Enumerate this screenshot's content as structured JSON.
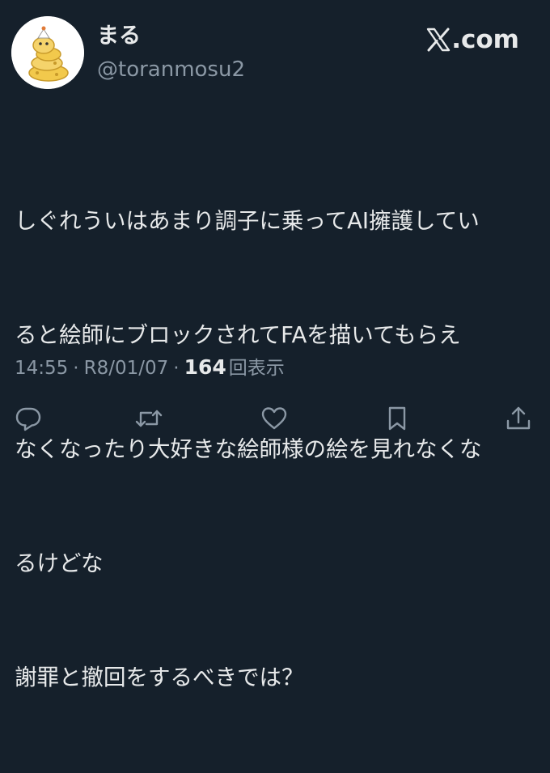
{
  "user": {
    "display_name": "まる",
    "handle": "@toranmosu2",
    "avatar_icon": "yellow-snake-avatar"
  },
  "brand": {
    "logo_icon": "x-logo-icon",
    "logo_text": ".com"
  },
  "tweet": {
    "lines": [
      "しぐれういはあまり調子に乗ってAI擁護してい",
      "ると絵師にブロックされてFAを描いてもらえ",
      "なくなったり大好きな絵師様の絵を見れなくな",
      "るけどな",
      "謝罪と撤回をするべきでは？"
    ],
    "time": "14:55",
    "separator": "·",
    "date": "R8/01/07",
    "views_count": "164",
    "views_label": "回表示"
  },
  "actions": {
    "reply_icon": "reply-icon",
    "retweet_icon": "retweet-icon",
    "like_icon": "heart-icon",
    "bookmark_icon": "bookmark-icon",
    "share_icon": "share-icon"
  },
  "colors": {
    "background": "#15202b",
    "text": "#e7e9ea",
    "secondary": "#8b98a5",
    "avatar_yellow": "#f5d36b"
  }
}
